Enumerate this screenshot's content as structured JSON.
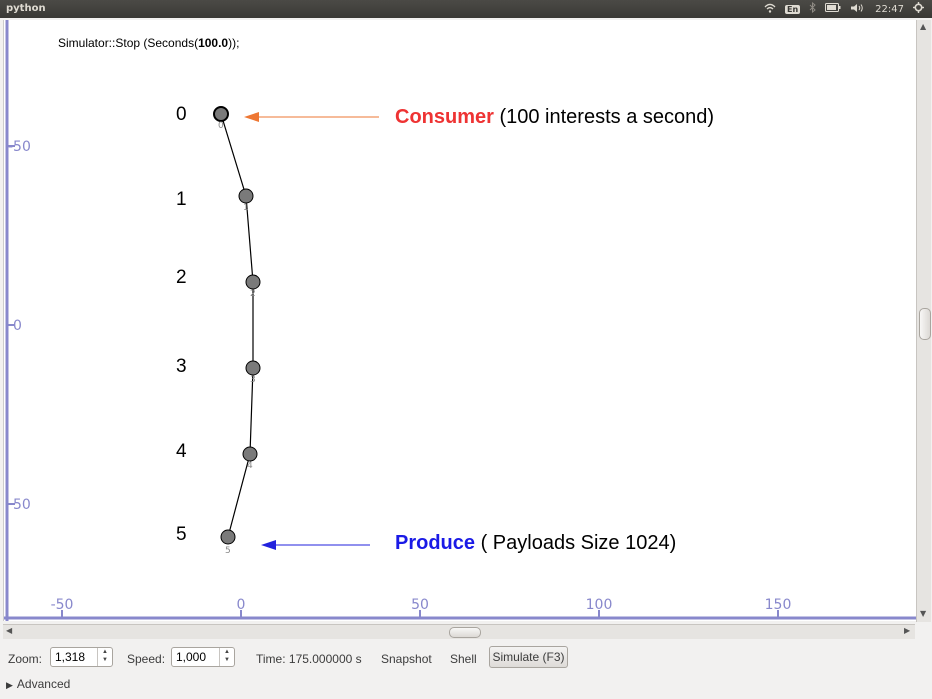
{
  "window": {
    "title": "python",
    "tray": {
      "keyboard_layout": "En",
      "clock": "22:47",
      "icons": [
        "wifi-icon",
        "bluetooth-icon",
        "battery-icon",
        "volume-icon"
      ]
    }
  },
  "canvas": {
    "code_prefix": "Simulator::Stop (Seconds(",
    "code_value": "100.0",
    "code_suffix": "));",
    "axis_color": "#8888cc",
    "y_axis_ticks": [
      "-50",
      "0",
      "50"
    ],
    "x_axis_ticks": [
      "-50",
      "0",
      "50",
      "100",
      "150"
    ],
    "nodes": [
      {
        "label": "0",
        "id": "0"
      },
      {
        "label": "1",
        "id": "1"
      },
      {
        "label": "2",
        "id": "2"
      },
      {
        "label": "3",
        "id": "3"
      },
      {
        "label": "4",
        "id": "4"
      },
      {
        "label": "5",
        "id": "5"
      }
    ],
    "consumer": {
      "keyword": "Consumer",
      "detail": "(100 interests a second)",
      "color": "#ee3333",
      "arrow_color": "#ee7733"
    },
    "producer": {
      "keyword": "Produce",
      "detail": "( Payloads Size 1024)",
      "color": "#1a1ae6",
      "arrow_color": "#2222dd"
    }
  },
  "toolbar": {
    "zoom_label": "Zoom:",
    "zoom_value": "1,318",
    "speed_label": "Speed:",
    "speed_value": "1,000",
    "time_label": "Time: 175.000000 s",
    "snapshot_label": "Snapshot",
    "shell_label": "Shell",
    "simulate_label": "Simulate (F3)"
  },
  "advanced": {
    "label": "Advanced"
  }
}
